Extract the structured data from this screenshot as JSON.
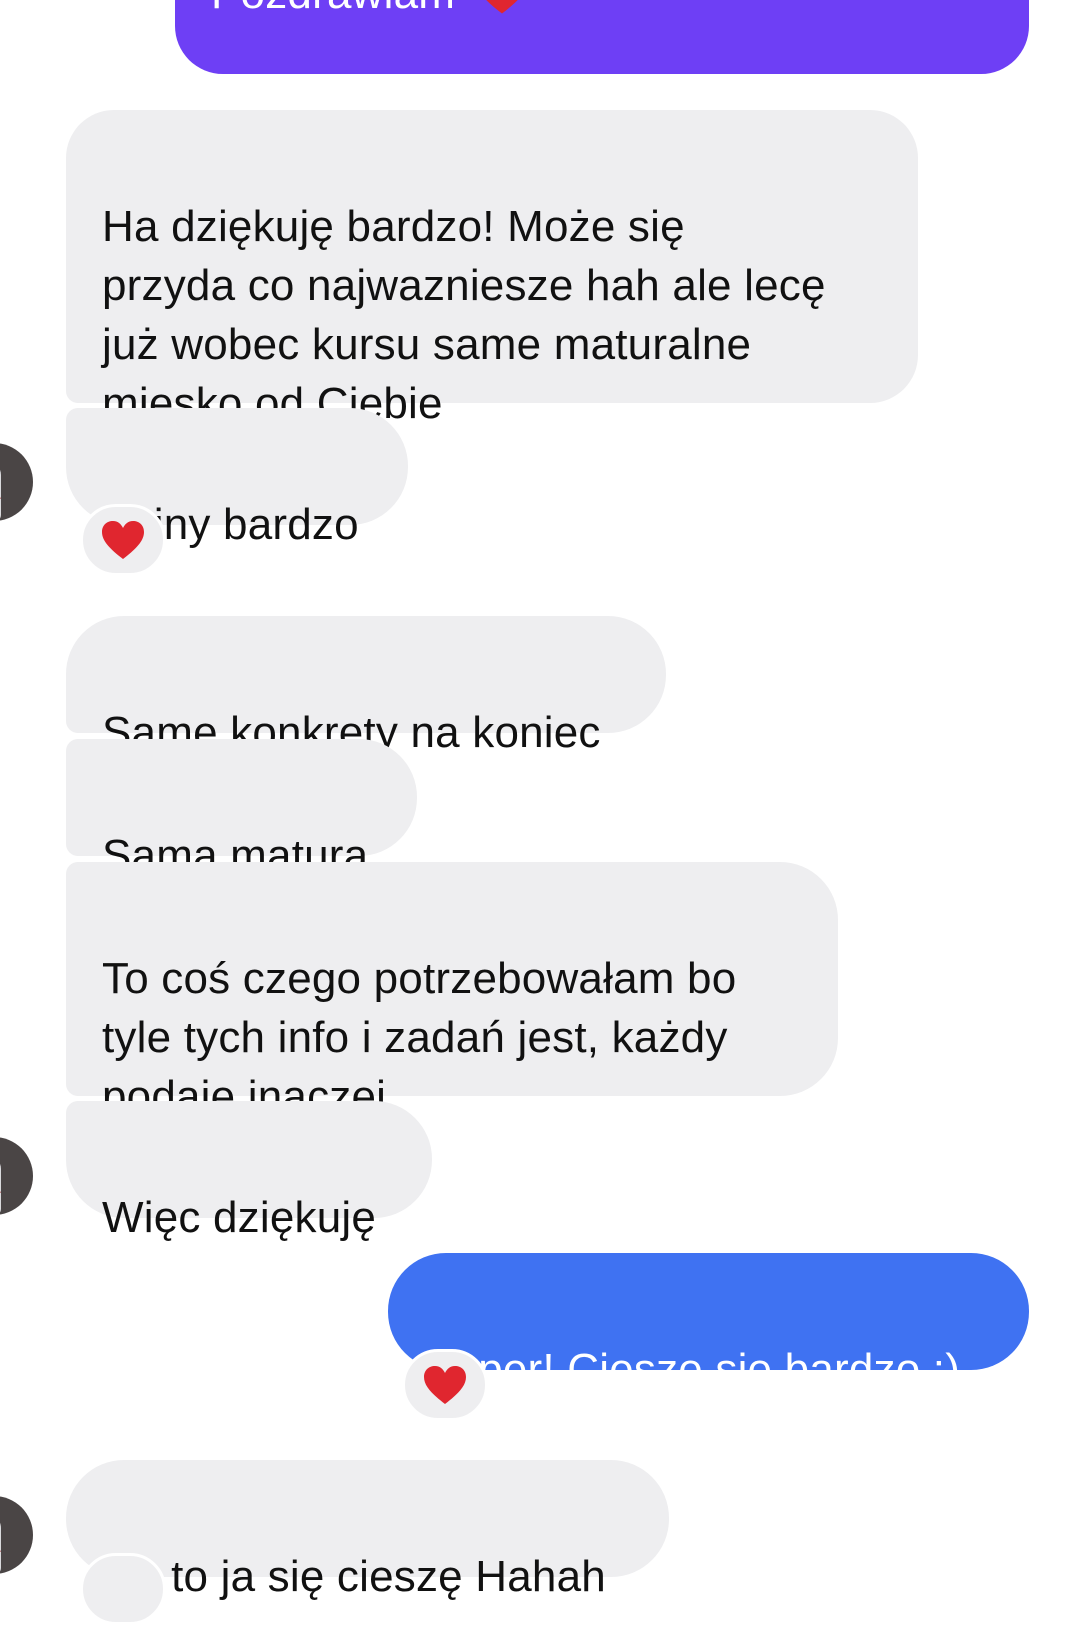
{
  "messages": [
    {
      "id": "m0",
      "sender": "me",
      "text": "Pozdrawiam",
      "emoji": "heart"
    },
    {
      "id": "m1",
      "sender": "other",
      "text": "Ha dziękuję bardzo! Może się\nprzyda co najwazniesze hah ale lecę\njuż wobec kursu same maturalne\nmiesko od Ciebie"
    },
    {
      "id": "m2",
      "sender": "other",
      "text": "Fajny bardzo",
      "reaction": "heart"
    },
    {
      "id": "m3",
      "sender": "other",
      "text": "Same konkrety na koniec"
    },
    {
      "id": "m4",
      "sender": "other",
      "text": "Sama matura"
    },
    {
      "id": "m5",
      "sender": "other",
      "text": "To coś czego potrzebowałam bo\ntyle tych info i zadań jest, każdy\npodaje inaczej"
    },
    {
      "id": "m6",
      "sender": "other",
      "text": "Więc dziękuję"
    },
    {
      "id": "m7",
      "sender": "me",
      "text": "Super! Cieszę się bardzo :)",
      "reaction": "heart"
    },
    {
      "id": "m8",
      "sender": "other",
      "text": "No to ja się cieszę Hahah"
    }
  ],
  "colors": {
    "incoming_bubble": "#eeeef0",
    "outgoing_purple": "#6e3ff5",
    "outgoing_blue": "#3f72f2",
    "reaction_heart": "#e0262f"
  },
  "icons": {
    "reaction": "red-heart-icon",
    "avatar": "user-avatar"
  }
}
